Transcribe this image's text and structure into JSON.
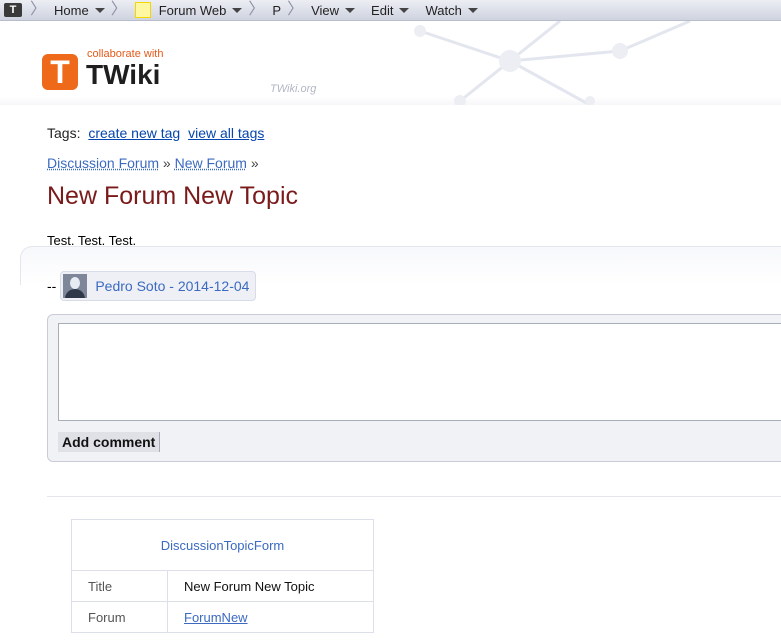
{
  "topnav": {
    "tw_icon": "T",
    "home": "Home",
    "web": "Forum Web",
    "page": "P",
    "view": "View",
    "edit": "Edit",
    "watch": "Watch",
    "web_color": "#fff8a0"
  },
  "logo": {
    "letter": "T",
    "tagline": "collaborate with",
    "name": "TWiki",
    "site": "TWiki.org",
    "accent": "#ee6a1a"
  },
  "tags": {
    "label": "Tags:",
    "create": "create new tag",
    "view_all": "view all tags"
  },
  "breadcrumb": {
    "item1": "Discussion Forum",
    "sep": "»",
    "item2": "New Forum"
  },
  "topic": {
    "title": "New Forum New Topic",
    "body": "Test. Test. Test.",
    "title_color": "#7a1a1a"
  },
  "signature": {
    "dash": "--",
    "author": "Pedro Soto - 2014-12-04"
  },
  "comment": {
    "value": "",
    "button": "Add comment"
  },
  "form": {
    "name": "DiscussionTopicForm",
    "rows": [
      {
        "label": "Title",
        "value": "New Forum New Topic"
      },
      {
        "label": "Forum",
        "value": "ForumNew"
      }
    ]
  }
}
